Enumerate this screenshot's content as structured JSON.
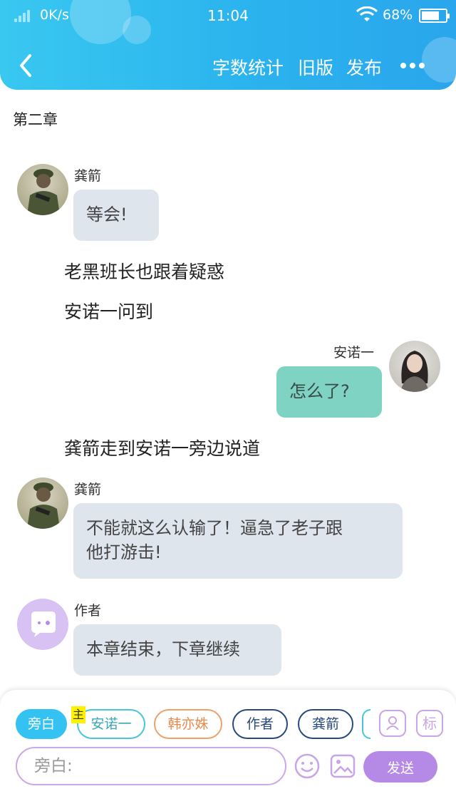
{
  "status_bar": {
    "network_speed": "0K/s",
    "time": "11:04",
    "battery": "68%"
  },
  "header": {
    "actions": {
      "word_count": "字数统计",
      "old_version": "旧版",
      "publish": "发布"
    }
  },
  "chapter": {
    "title": "第二章"
  },
  "messages": [
    {
      "speaker": "龚箭",
      "text": "等会!"
    },
    {
      "narration": "老黑班长也跟着疑惑"
    },
    {
      "narration": "安诺一问到"
    },
    {
      "speaker": "安诺一",
      "text": "怎么了?"
    },
    {
      "narration": "龚箭走到安诺一旁边说道"
    },
    {
      "speaker": "龚箭",
      "text_line1": "不能就这么认输了！逼急了老子跟",
      "text_line2": "他打游击!"
    },
    {
      "speaker": "作者",
      "text": "本章结束，下章继续"
    }
  ],
  "composer": {
    "roles": [
      "旁白",
      "安诺一",
      "韩亦姝",
      "作者",
      "龚箭"
    ],
    "host_badge": "主",
    "tag_icon_label": "标",
    "input_placeholder": "旁白:",
    "send_label": "发送"
  }
}
